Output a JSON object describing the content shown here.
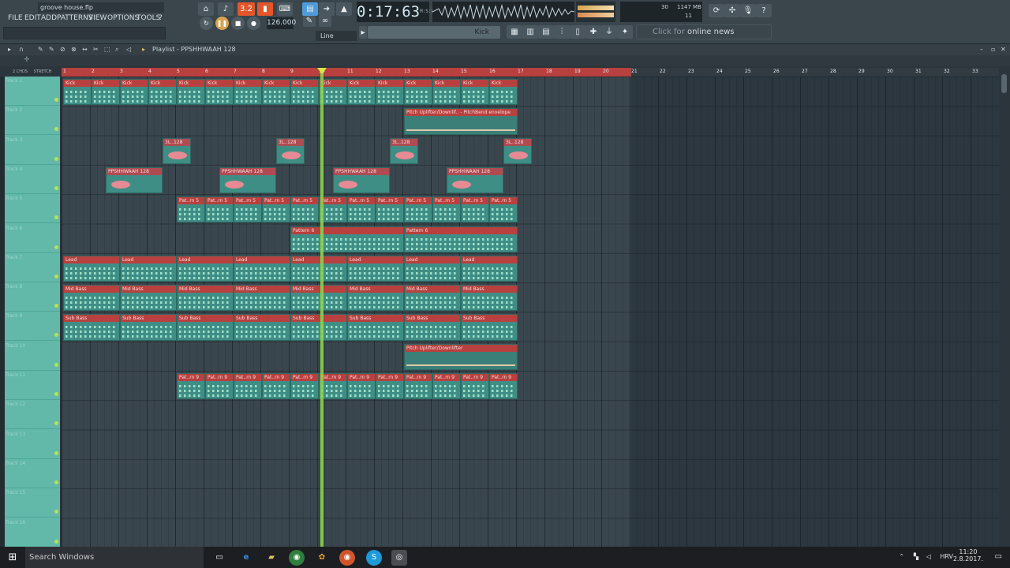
{
  "project_file": "groove house.flp",
  "menu": [
    "FILE",
    "EDIT",
    "ADD",
    "PATTERNS",
    "VIEW",
    "OPTIONS",
    "TOOLS",
    "?"
  ],
  "toolbar": {
    "pattern_number": "3.2",
    "tempo": "126.000",
    "time": "0:17:63",
    "time_unit": "M:S:CS",
    "cpu": "30",
    "memory": "1147 MB",
    "voices": "11",
    "mode": "Line",
    "selected_pattern": "Kick",
    "news_prefix": "Click for",
    "news_text": "online news"
  },
  "playlist": {
    "title": "Playlist - PPSHHWAAH 128",
    "snap": "2 CHDS",
    "stretch": "STRETCH",
    "bars": [
      "1",
      "2",
      "3",
      "4",
      "5",
      "6",
      "7",
      "8",
      "9",
      "10",
      "11",
      "12",
      "13",
      "14",
      "15",
      "16",
      "17",
      "18",
      "19",
      "20",
      "21",
      "22",
      "23",
      "24",
      "25",
      "26",
      "27",
      "28",
      "29",
      "30",
      "31",
      "32",
      "33"
    ]
  },
  "tracks": [
    "Track 1",
    "Track 2",
    "Track 3",
    "Track 4",
    "Track 5",
    "Track 6",
    "Track 7",
    "Track 8",
    "Track 9",
    "Track 10",
    "Track 11",
    "Track 12",
    "Track 13",
    "Track 14",
    "Track 15",
    "Track 16"
  ],
  "clip_labels": {
    "kick": "Kick",
    "pitch_env": "Pitch Uplifter/Downlif.. - PitchBend envelope",
    "three_l": "3L..128",
    "ppsh": "PPSHHWAAH 128",
    "pat5": "Pat..rn 5",
    "pat6": "Pattern 6",
    "lead": "Lead",
    "midbass": "Mid Bass",
    "subbass": "Sub Bass",
    "uplifter": "Pitch Uplifter/Downlifter",
    "pat9": "Pat..rn 9"
  },
  "taskbar": {
    "search": "Search Windows",
    "language": "HRV",
    "clock_time": "11:20",
    "clock_date": "2.8.2017."
  }
}
